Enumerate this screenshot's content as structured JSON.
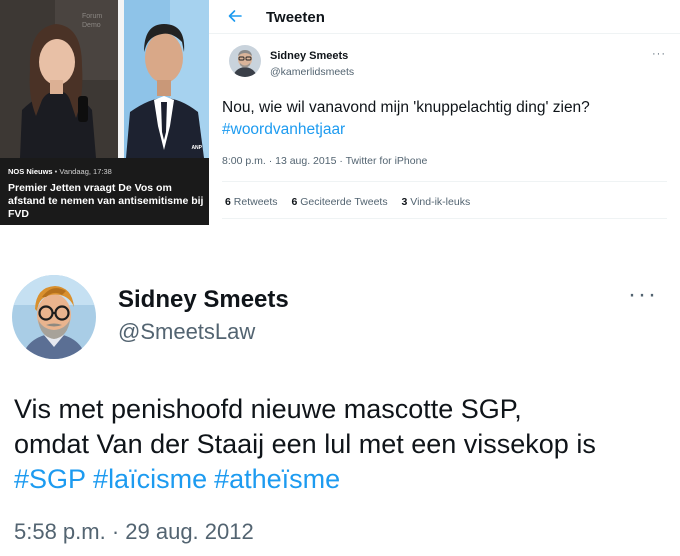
{
  "news_card": {
    "source": "NOS Nieuws",
    "separator": " • ",
    "time": "Vandaag, 17:38",
    "headline": "Premier Jetten vraagt De Vos om afstand te nemen van antisemitisme bij FVD",
    "photo_credit": "ANP"
  },
  "tweet_small": {
    "header_title": "Tweeten",
    "author_name": "Sidney Smeets",
    "author_handle": "@kamerlidsmeets",
    "more": "···",
    "text": "Nou, wie wil vanavond mijn 'knuppelachtig ding' zien?",
    "hashtag": "#woordvanhetjaar",
    "timestamp": "8:00 p.m. · 13 aug. 2015",
    "meta_separator": " · ",
    "source": "Twitter for iPhone",
    "stats": [
      {
        "count": "6",
        "label": "Retweets"
      },
      {
        "count": "6",
        "label": "Geciteerde Tweets"
      },
      {
        "count": "3",
        "label": "Vind-ik-leuks"
      }
    ]
  },
  "tweet_large": {
    "author_name": "Sidney Smeets",
    "author_handle": "@SmeetsLaw",
    "more": "···",
    "text_line1": "Vis met penishoofd nieuwe mascotte SGP,",
    "text_line2": "omdat Van der Staaij een lul met een vissekop is",
    "hashtags": [
      "#SGP",
      "#laïcisme",
      "#atheïsme"
    ],
    "timestamp": "5:58 p.m. · 29 aug. 2012"
  },
  "colors": {
    "link": "#1d9bf0",
    "text": "#0f1419",
    "muted": "#536471",
    "divider": "#eff3f4",
    "news_bg": "#1a1a1a"
  },
  "icons": {
    "back": "arrow-left-icon",
    "more": "more-dots-icon"
  }
}
